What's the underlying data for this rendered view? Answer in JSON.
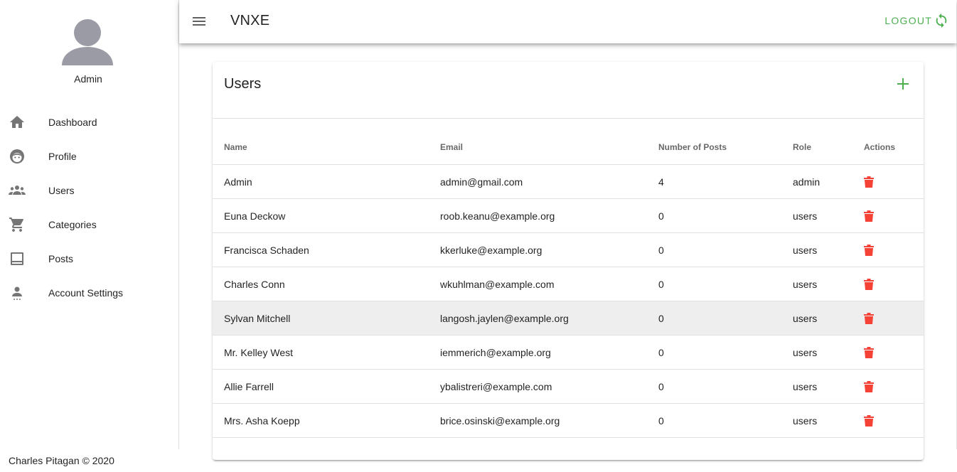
{
  "sidebar": {
    "user_name": "Admin",
    "items": [
      {
        "label": "Dashboard",
        "icon": "home-icon"
      },
      {
        "label": "Profile",
        "icon": "face-icon"
      },
      {
        "label": "Users",
        "icon": "people-icon"
      },
      {
        "label": "Categories",
        "icon": "cart-icon"
      },
      {
        "label": "Posts",
        "icon": "posts-icon"
      },
      {
        "label": "Account Settings",
        "icon": "account-settings-icon"
      }
    ]
  },
  "appbar": {
    "title": "VNXE",
    "logout_label": "LOGOUT"
  },
  "card": {
    "title": "Users"
  },
  "table": {
    "headers": {
      "name": "Name",
      "email": "Email",
      "posts": "Number of Posts",
      "role": "Role",
      "actions": "Actions"
    },
    "rows": [
      {
        "name": "Admin",
        "email": "admin@gmail.com",
        "posts": "4",
        "role": "admin"
      },
      {
        "name": "Euna Deckow",
        "email": "roob.keanu@example.org",
        "posts": "0",
        "role": "users"
      },
      {
        "name": "Francisca Schaden",
        "email": "kkerluke@example.org",
        "posts": "0",
        "role": "users"
      },
      {
        "name": "Charles Conn",
        "email": "wkuhlman@example.com",
        "posts": "0",
        "role": "users"
      },
      {
        "name": "Sylvan Mitchell",
        "email": "langosh.jaylen@example.org",
        "posts": "0",
        "role": "users"
      },
      {
        "name": "Mr. Kelley West",
        "email": "iemmerich@example.org",
        "posts": "0",
        "role": "users"
      },
      {
        "name": "Allie Farrell",
        "email": "ybalistreri@example.com",
        "posts": "0",
        "role": "users"
      },
      {
        "name": "Mrs. Asha Koepp",
        "email": "brice.osinski@example.org",
        "posts": "0",
        "role": "users"
      }
    ]
  },
  "footer": {
    "text": "Charles Pitagan © 2020"
  },
  "colors": {
    "accent": "#4caf50",
    "delete": "#f44336",
    "icon_gray": "#757575",
    "avatar": "#9e9eaa",
    "highlight_row": "#eeeeee"
  }
}
